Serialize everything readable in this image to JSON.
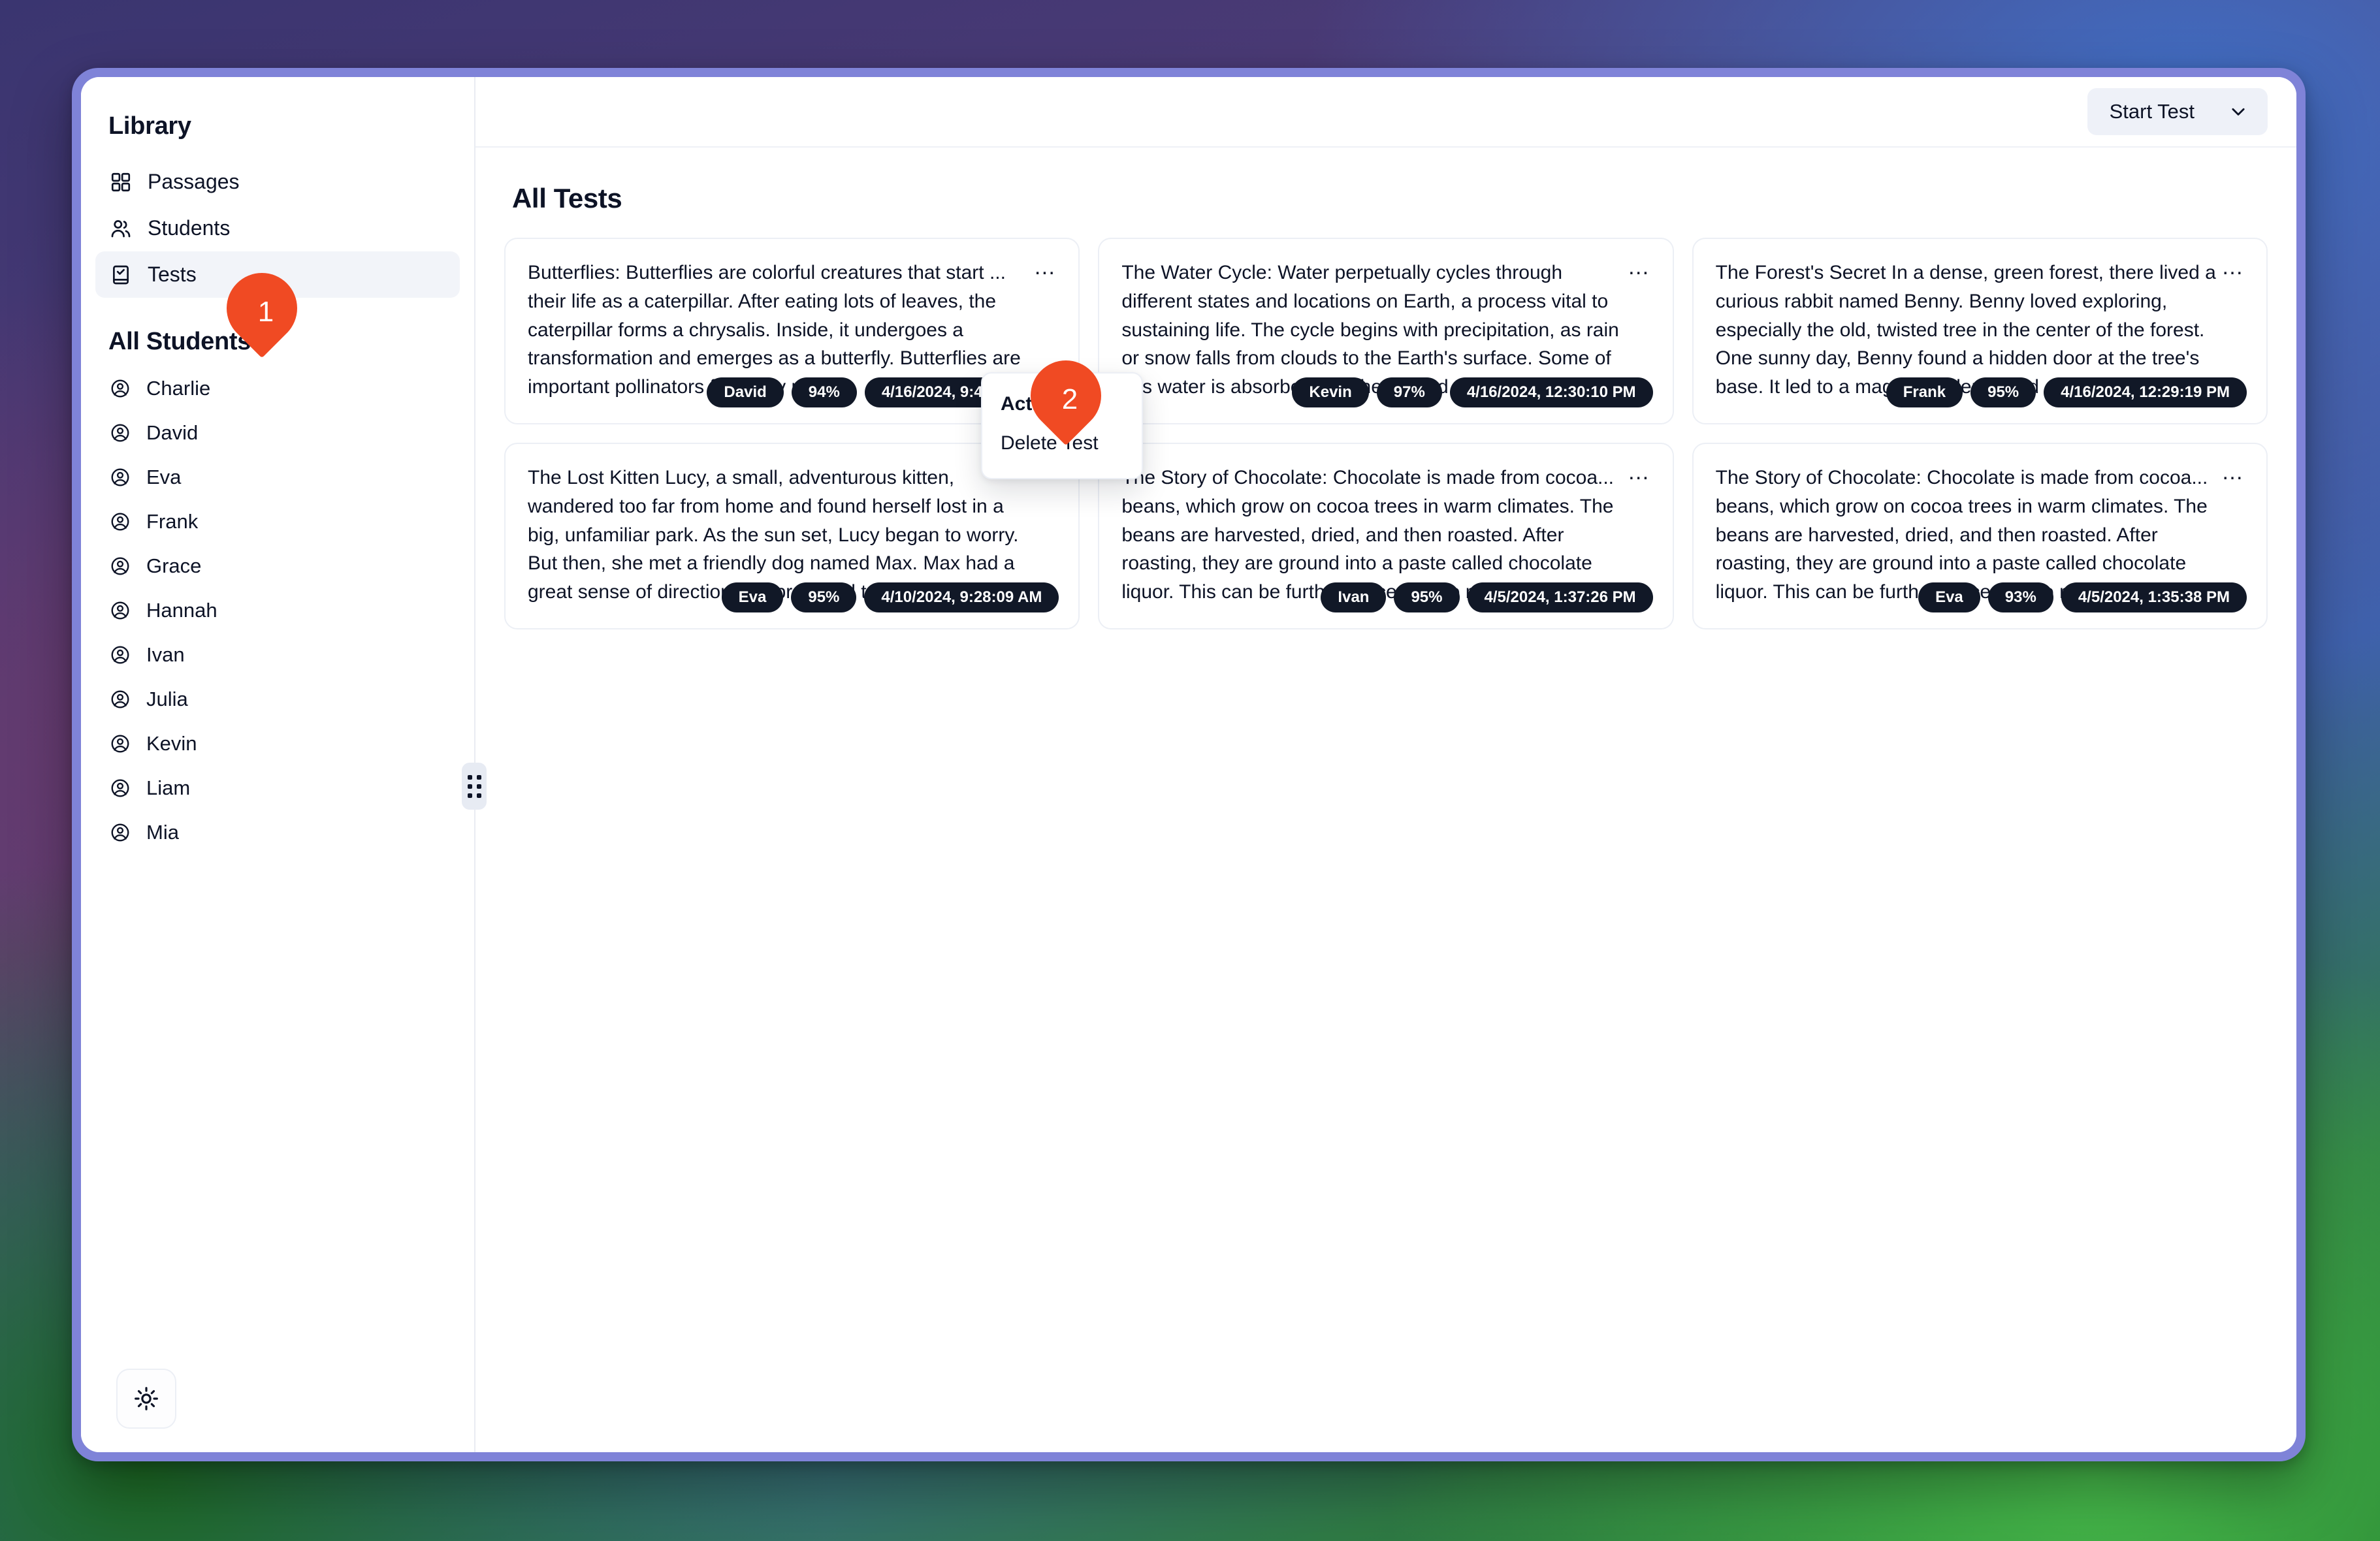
{
  "window": {
    "accent_border_color": "#7f83d8",
    "badge_bg_color": "#111827",
    "marker_color": "#f04a23"
  },
  "sidebar": {
    "title": "Library",
    "nav_items": [
      {
        "label": "Passages",
        "icon": "grid-icon",
        "active": false
      },
      {
        "label": "Students",
        "icon": "users-icon",
        "active": false
      },
      {
        "label": "Tests",
        "icon": "clipboard-check-icon",
        "active": true
      }
    ],
    "students_heading": "All Students",
    "students": [
      {
        "label": "Charlie",
        "icon": "user-circle-icon"
      },
      {
        "label": "David",
        "icon": "user-circle-icon"
      },
      {
        "label": "Eva",
        "icon": "user-circle-icon"
      },
      {
        "label": "Frank",
        "icon": "user-circle-icon"
      },
      {
        "label": "Grace",
        "icon": "user-circle-icon"
      },
      {
        "label": "Hannah",
        "icon": "user-circle-icon"
      },
      {
        "label": "Ivan",
        "icon": "user-circle-icon"
      },
      {
        "label": "Julia",
        "icon": "user-circle-icon"
      },
      {
        "label": "Kevin",
        "icon": "user-circle-icon"
      },
      {
        "label": "Liam",
        "icon": "user-circle-icon"
      },
      {
        "label": "Mia",
        "icon": "user-circle-icon"
      }
    ],
    "theme_toggle_icon": "sun-icon",
    "resize_handle_icon": "drag-dots-icon"
  },
  "topbar": {
    "start_test_label": "Start Test",
    "start_test_chevron_icon": "chevron-down-icon"
  },
  "main": {
    "page_title": "All Tests",
    "card_menu_glyph": "…",
    "cards": [
      {
        "text": "Butterflies: Butterflies are colorful creatures that start ... their life as a caterpillar. After eating lots of leaves, the caterpillar forms a chrysalis. Inside, it undergoes a transformation and emerges as a butterfly. Butterflies are important pollinators for many plants.",
        "student": "David",
        "score": "94%",
        "timestamp": "4/16/2024, 9:46:24 PM"
      },
      {
        "text": "The Water Cycle: Water perpetually cycles through different states and locations on Earth, a process vital to sustaining life. The cycle begins with precipitation, as rain or snow falls from clouds to the Earth's surface. Some of this water is absorbed into the ground, replenishing aquifers, while the rest flows into streams.",
        "student": "Kevin",
        "score": "97%",
        "timestamp": "4/16/2024, 12:30:10 PM"
      },
      {
        "text": "The Forest's Secret In a dense, green forest, there lived a curious rabbit named Benny. Benny loved exploring, especially the old, twisted tree in the center of the forest. One sunny day, Benny found a hidden door at the tree's base. It led to a magical underground cave filled with sparkling crystals and glowing mushrooms.",
        "student": "Frank",
        "score": "95%",
        "timestamp": "4/16/2024, 12:29:19 PM"
      },
      {
        "text": "The Lost Kitten Lucy, a small, adventurous kitten, wandered too far from home and found herself lost in a big, unfamiliar park. As the sun set, Lucy began to worry. But then, she met a friendly dog named Max. Max had a great sense of direction and promised to help Lucy find her way back home.",
        "student": "Eva",
        "score": "95%",
        "timestamp": "4/10/2024, 9:28:09 AM"
      },
      {
        "text": "The Story of Chocolate: Chocolate is made from cocoa... beans, which grow on cocoa trees in warm climates. The beans are harvested, dried, and then roasted. After roasting, they are ground into a paste called chocolate liquor. This can be further processed to make various types of chocolate.",
        "student": "Ivan",
        "score": "95%",
        "timestamp": "4/5/2024, 1:37:26 PM"
      },
      {
        "text": "The Story of Chocolate: Chocolate is made from cocoa... beans, which grow on cocoa trees in warm climates. The beans are harvested, dried, and then roasted. After roasting, they are ground into a paste called chocolate liquor. This can be further processed to make various types of chocolate.",
        "student": "Eva",
        "score": "93%",
        "timestamp": "4/5/2024, 1:35:38 PM"
      }
    ]
  },
  "dropdown": {
    "heading": "Actions",
    "items": [
      {
        "label": "Delete Test"
      }
    ]
  },
  "markers": [
    {
      "number": "1"
    },
    {
      "number": "2"
    }
  ]
}
